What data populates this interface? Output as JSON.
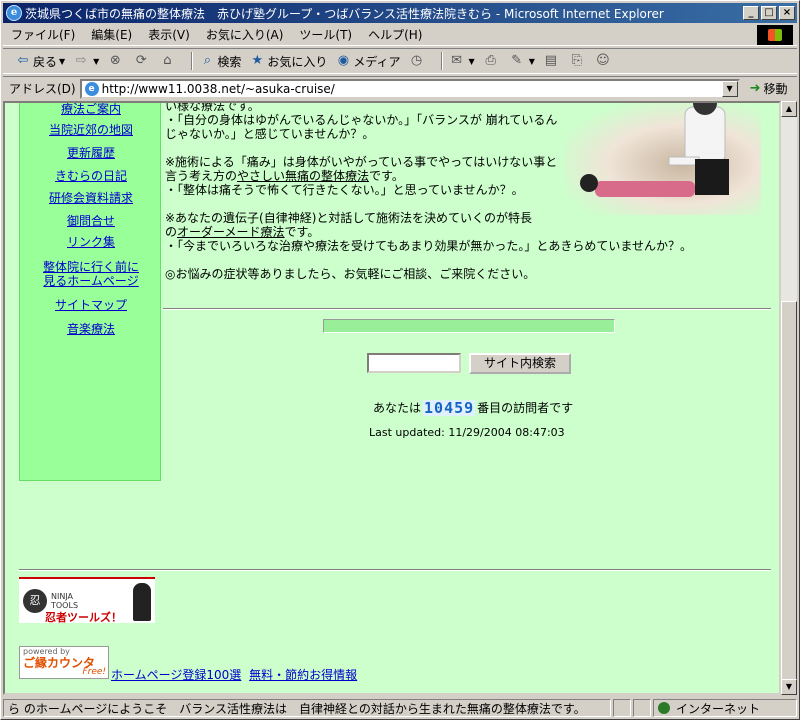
{
  "window": {
    "title": "茨城県つくば市の無痛の整体療法　赤ひげ塾グループ・つばバランス活性療法院きむら - Microsoft Internet Explorer",
    "minimize": "_",
    "maximize": "□",
    "close": "×"
  },
  "menu": [
    "ファイル(F)",
    "編集(E)",
    "表示(V)",
    "お気に入り(A)",
    "ツール(T)",
    "ヘルプ(H)"
  ],
  "toolbar": {
    "back": "戻る",
    "search": "検索",
    "favorites": "お気に入り",
    "media": "メディア"
  },
  "address": {
    "label": "アドレス(D)",
    "url": "http://www11.0038.net/~asuka-cruise/",
    "go": "移動"
  },
  "sidebar": {
    "items": [
      "療法ご案内",
      "当院近郊の地図",
      "更新履歴",
      "きむらの日記",
      "研修会資料請求",
      "御問合せ",
      "リンク集",
      "整体院に行く前に",
      "見るホームページ",
      "サイトマップ",
      "音楽療法"
    ]
  },
  "content": {
    "l0": "い様な療法です。",
    "l1": "・「自分の身体はゆがんでいるんじゃないか。」「バランスが 崩れているん",
    "l2": "じゃないか。」と感じていませんか？。",
    "l3": "※施術による「痛み」は身体がいやがっている事でやってはいけない事と",
    "l4a": "言う考え方の",
    "l4link": "やさしい無痛の整体療法",
    "l4b": "です。",
    "l5": "・「整体は痛そうで怖くて行きたくない。」と思っていませんか？。",
    "l6": "※あなたの遺伝子(自律神経)と対話して施術法を決めていくのが特長",
    "l7a": "の",
    "l7link": "オーダーメード療法",
    "l7b": "です。",
    "l8": "・「今までいろいろな治療や療法を受けてもあまり効果が無かった。」とあきらめていませんか？。",
    "l9": "◎お悩みの症状等ありましたら、お気軽にご相談、ご来院ください。"
  },
  "search_button": "サイト内検索",
  "visitor": {
    "prefix": "あなたは",
    "count": "10459",
    "suffix": "番目の訪問者です"
  },
  "updated": "Last updated: 11/29/2004 08:47:03",
  "ninja": {
    "l1": "NINJA",
    "l2": "TOOLS",
    "jp": "忍者ツールズ！"
  },
  "powered": {
    "p1": "powered by",
    "p2": "ご縁カウンタ",
    "p3": "Free!"
  },
  "bottom_links": [
    "ホームページ登録100選",
    "無料・節約お得情報"
  ],
  "status": {
    "text": "ら  のホームページにようこそ　バランス活性療法は　自律神経との対話から生まれた無痛の整体療法です。",
    "zone": "インターネット"
  }
}
